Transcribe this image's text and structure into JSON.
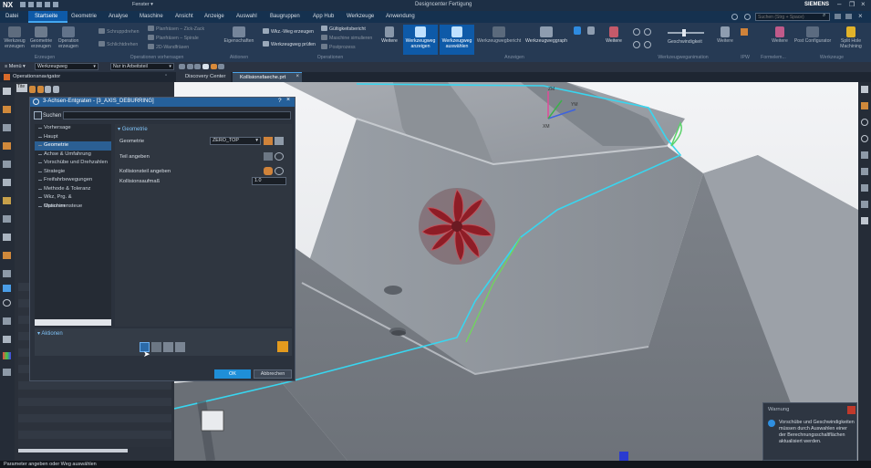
{
  "app": {
    "logo": "NX",
    "title": "Designcenter Fertigung",
    "brand": "SIEMENS",
    "window_menu": "Fenster"
  },
  "search": {
    "placeholder": "Suchen (Strg + Space)"
  },
  "menubar": {
    "items": [
      "Datei",
      "Startseite",
      "Geometrie",
      "Analyse",
      "Maschine",
      "Ansicht",
      "Anzeige",
      "Auswahl",
      "Baugruppen",
      "App Hub",
      "Werkzeuge",
      "Anwendung"
    ],
    "active": "Startseite"
  },
  "ribbon": {
    "groups": [
      "Erzeugen",
      "Operationen vorhersagen",
      "Aktionen",
      "Operationen",
      "Anzeigen",
      "Werkzeugweganimation",
      "IPW",
      "Formelem...",
      "Werkzeuge"
    ],
    "erzeugen": {
      "btn1": "Werkzeug erzeugen",
      "btn2": "Geometrie erzeugen",
      "btn3": "Operation erzeugen"
    },
    "predict": {
      "i1": "Schruppdrehen",
      "i2": "Schlichtdrehen",
      "i3": "Planfräsen – Zick-Zack",
      "i4": "Planfräsen – Spirale",
      "i5": "2D-Wandfräsen"
    },
    "aktionen": {
      "btn": "Eigenschaften"
    },
    "operationen": {
      "i1": "Wkz.-Weg erzeugen",
      "i2": "Werkzeugweg prüfen",
      "i3": "Gültigkeitsbericht",
      "i4": "Maschine simulieren",
      "i5": "Postprozess",
      "more": "Weitere"
    },
    "anzeigen": {
      "b1": "Werkzeugweg anzeigen",
      "b2": "Werkzeugweg auswählen",
      "b3": "Werkzeugwegbericht",
      "b4": "Werkzeugweggraph",
      "more": "Weitere"
    },
    "anim": {
      "speed": "Geschwindigkeit",
      "more": "Weitere"
    },
    "formelem": {
      "more": "Weitere"
    },
    "werkzeuge": {
      "b1": "Post Configurator",
      "b2": "Split Hole Machining"
    }
  },
  "toolbar2": {
    "menu": "Menü",
    "filter": "Werkzeugweg",
    "scope": "Nur in Arbeitsteil"
  },
  "tabs": {
    "nav": "Operationsnavigator",
    "t1": "Discovery Center",
    "t2": "Kollisionsfaeche.prt"
  },
  "navigator": {
    "col": "Tite"
  },
  "dialog": {
    "title": "3-Achsen-Entgraten - [3_AXIS_DEBURRING]",
    "search_label": "Suchen",
    "tree": [
      "Vorhersage",
      "Haupt",
      "Geometrie",
      "Achse & Umfahrung",
      "Vorschübe und Drehzahlen",
      "Strategie",
      "Freifahrbewegungen",
      "Methode & Toleranz",
      "Wkz, Prg. & Maschinensteue",
      "Optionen"
    ],
    "selected": "Geometrie",
    "section": "Geometrie",
    "geom_label": "Geometrie",
    "geom_value": "ZERO_TOP",
    "teil_label": "Teil angeben",
    "koll_label": "Kollisionsteil angeben",
    "offset_label": "Kollisionsaufmaß",
    "offset_value": "1.0",
    "actions_label": "Aktionen",
    "ok": "OK",
    "cancel": "Abbrechen"
  },
  "axes": {
    "x": "XM",
    "y": "YM",
    "z": "ZM"
  },
  "warning": {
    "title": "Warnung",
    "text": "Vorschübe und Geschwindigkeiten müssen durch Auswahlen einer der Berechnungsschaltflächen aktualisiert werden."
  },
  "status": {
    "text": "Parameter angeben oder Weg auswählen"
  },
  "colors": {
    "accent": "#1f8fd8",
    "ribbon": "#263a54",
    "emblem": "#8e1d26",
    "toolpath": "#38d6f0"
  }
}
